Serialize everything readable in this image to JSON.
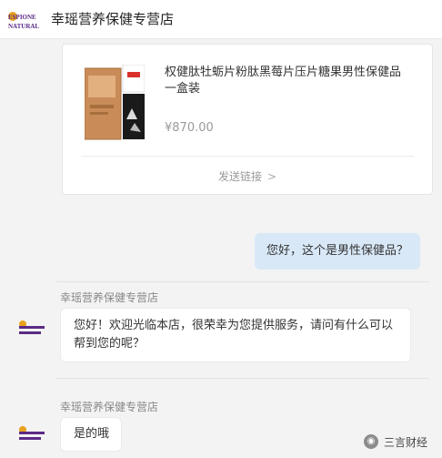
{
  "header": {
    "title": "幸瑶营养保健专营店",
    "logo_top": "ESPIONE",
    "logo_bottom": "NATURAL"
  },
  "product": {
    "name": "权健肽牡蛎片粉肽黑莓片压片糖果男性保健品 一盒装",
    "price": "¥870.00",
    "send_link": "发送链接",
    "chevron": ">"
  },
  "messages": [
    {
      "from": "user",
      "text": "您好，这个是男性保健品？"
    },
    {
      "from": "shop",
      "sender": "幸瑶营养保健专营店",
      "text": "您好！欢迎光临本店，很荣幸为您提供服务，请问有什么可以帮到您的呢？"
    },
    {
      "from": "shop",
      "sender": "幸瑶营养保健专营店",
      "text": "是的哦"
    }
  ],
  "watermark": {
    "text": "三言财经"
  }
}
